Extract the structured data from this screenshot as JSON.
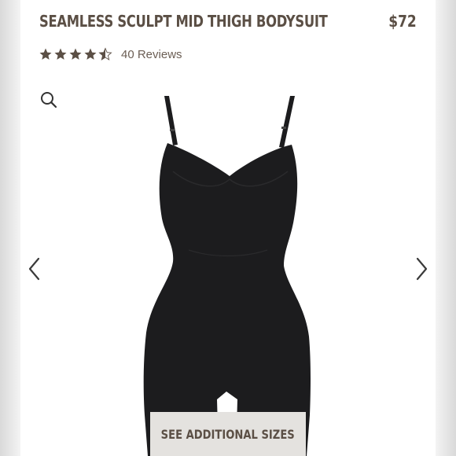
{
  "product": {
    "title": "SEAMLESS SCULPT MID THIGH BODYSUIT",
    "price": "$72",
    "rating": 4.5,
    "reviews_label": "40 Reviews",
    "image_name": "black-bodysuit-image"
  },
  "gallery": {
    "prev_icon": "chevron-left-icon",
    "next_icon": "chevron-right-icon",
    "zoom_icon": "search-icon"
  },
  "cta": {
    "sizes_label": "SEE ADDITIONAL SIZES"
  },
  "colors": {
    "text_brown": "#5b4f45",
    "star": "#5b4f45",
    "button_bg": "#e4e2df",
    "garment": "#1c1c1e"
  }
}
